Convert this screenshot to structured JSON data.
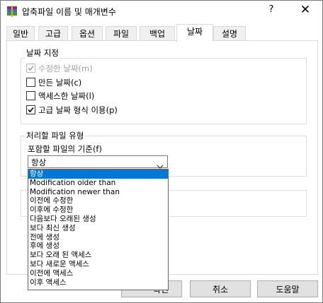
{
  "window": {
    "title": "압축파일 이름 및 매개변수",
    "help_label": "?",
    "close_label": "✕"
  },
  "tabs": [
    {
      "label": "일반"
    },
    {
      "label": "고급"
    },
    {
      "label": "옵션"
    },
    {
      "label": "파일"
    },
    {
      "label": "백업"
    },
    {
      "label": "날짜"
    },
    {
      "label": "설명"
    }
  ],
  "active_tab": "날짜",
  "date_group": {
    "label": "날짜 지정",
    "checkboxes": [
      {
        "label": "수정한 날짜(m)",
        "checked": true,
        "disabled": true
      },
      {
        "label": "만든 날짜(c)",
        "checked": false,
        "disabled": false
      },
      {
        "label": "액세스한 날짜(l)",
        "checked": false,
        "disabled": false
      },
      {
        "label": "고급 날짜 형식 이용(p)",
        "checked": true,
        "disabled": false
      }
    ]
  },
  "file_type_group": {
    "label": "처리할 파일 유형",
    "criteria_label": "포함할 파일의 기준(f)",
    "selected": "항상",
    "options": [
      "항상",
      "Modification older than",
      "Modification newer than",
      "이전에 수정한",
      "이후에 수정한",
      "다음보다 오래된 생성",
      "보다 최신 생성",
      "전에 생성",
      "후에 생성",
      "보다 오래 된 액세스",
      "보다 새로운 액세스",
      "이전에 액세스",
      "이후 액세스"
    ]
  },
  "buttons": {
    "ok_partial": "확인",
    "cancel": "취소",
    "help": "도움말"
  }
}
